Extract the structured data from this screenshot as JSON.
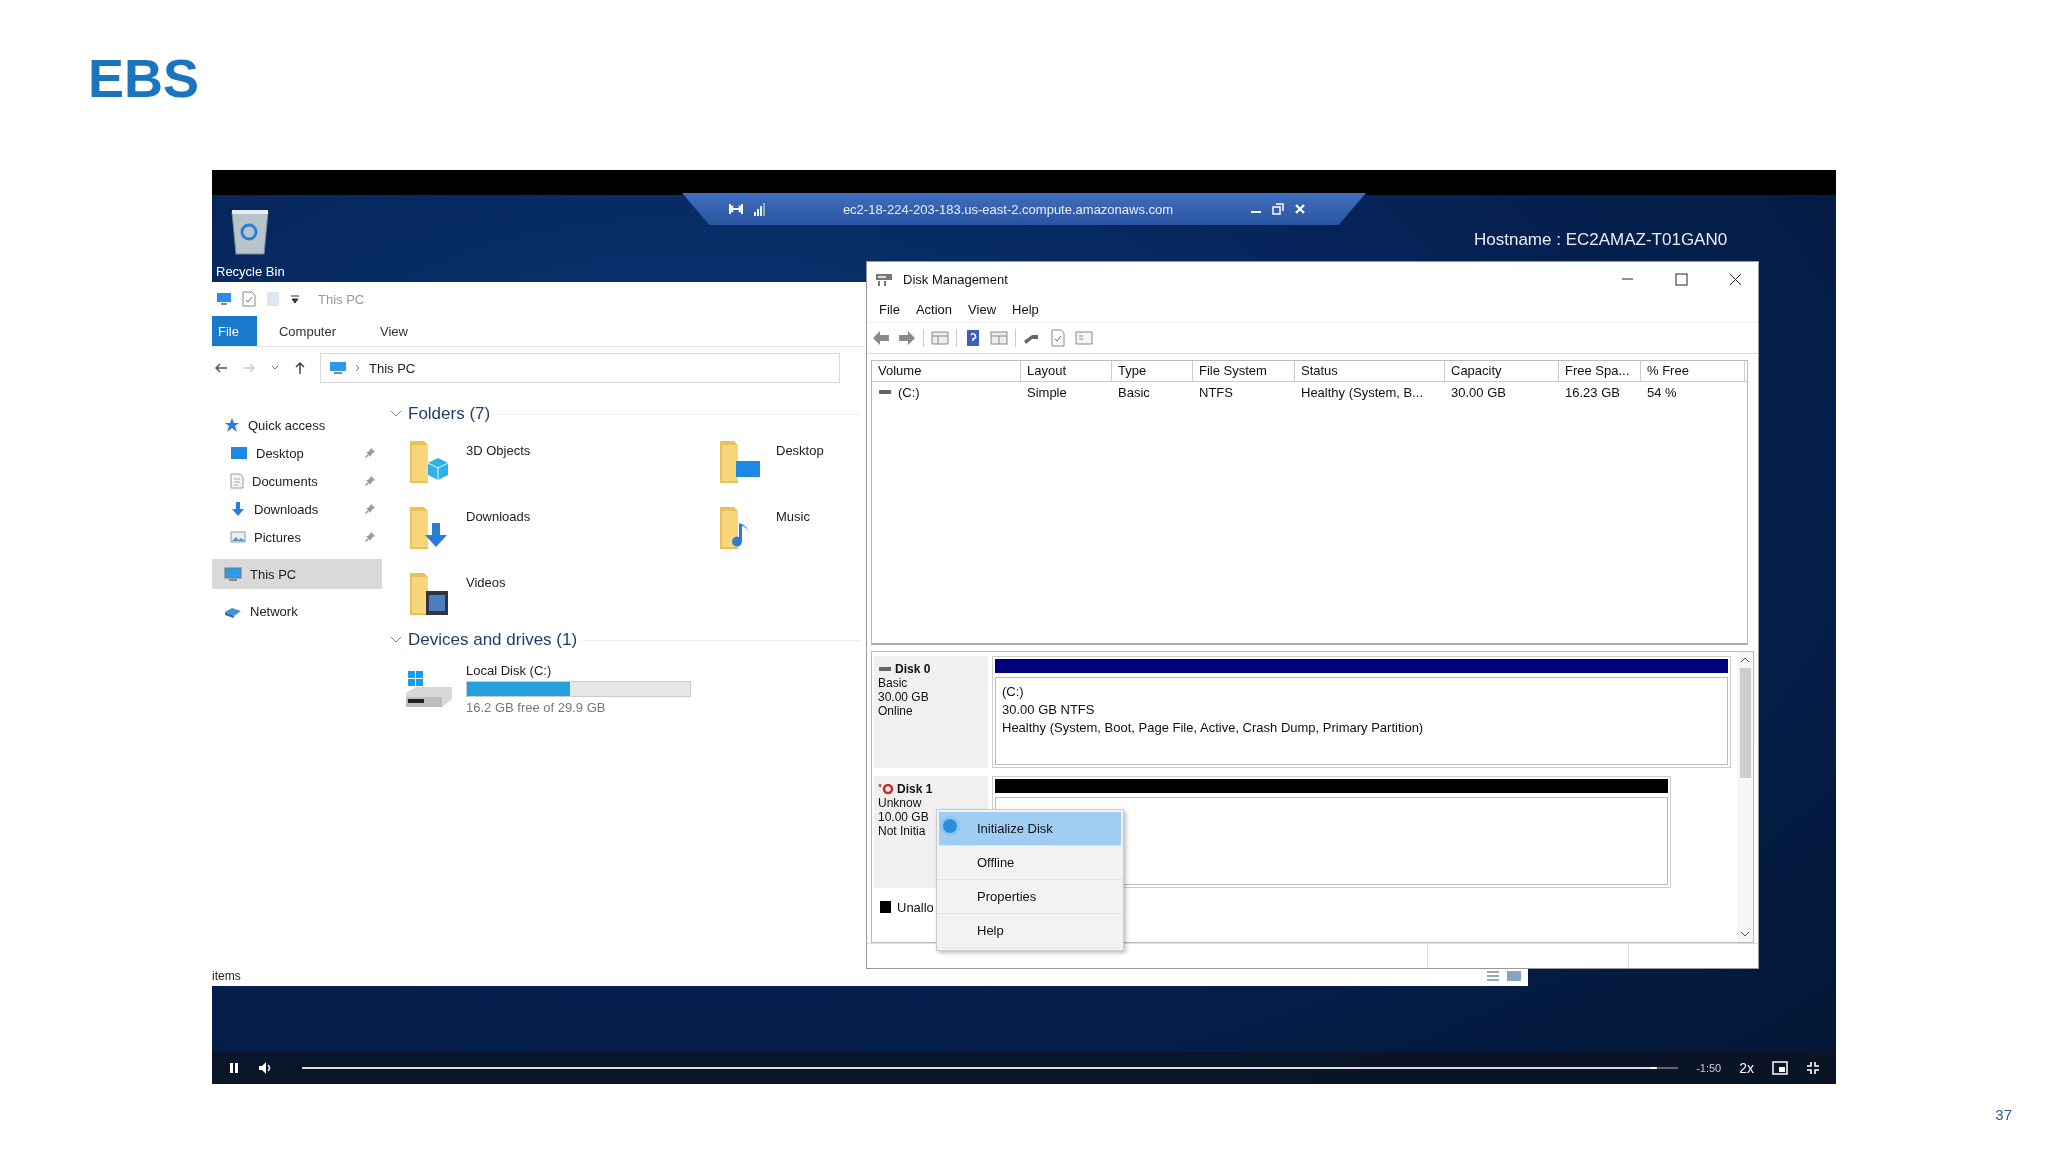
{
  "slide": {
    "title": "EBS",
    "page_number": "37"
  },
  "rdp_bar": {
    "host": "ec2-18-224-203-183.us-east-2.compute.amazonaws.com"
  },
  "desktop": {
    "icons": [
      {
        "label": "Recycle Bin"
      }
    ],
    "hostname": "Hostname : EC2AMAZ-T01GAN0"
  },
  "explorer": {
    "title": "This PC",
    "ribbon_tabs": [
      {
        "label": "File",
        "selected": true
      },
      {
        "label": "Computer",
        "selected": false
      },
      {
        "label": "View",
        "selected": false
      }
    ],
    "address": "This PC",
    "nav": [
      {
        "label": "Quick access",
        "selected": false,
        "children": [
          {
            "label": "Desktop",
            "pinned": true
          },
          {
            "label": "Documents",
            "pinned": true
          },
          {
            "label": "Downloads",
            "pinned": true
          },
          {
            "label": "Pictures",
            "pinned": true
          }
        ]
      },
      {
        "label": "This PC",
        "selected": true
      },
      {
        "label": "Network",
        "selected": false
      }
    ],
    "folders_heading": "Folders (7)",
    "folders": [
      {
        "label": "3D Objects"
      },
      {
        "label": "Desktop"
      },
      {
        "label": "Downloads"
      },
      {
        "label": "Music"
      },
      {
        "label": "Videos"
      }
    ],
    "devices_heading": "Devices and drives (1)",
    "drives": [
      {
        "name": "Local Disk (C:)",
        "level": 0.46,
        "free": "16.2 GB free of 29.9 GB"
      }
    ],
    "status": "items"
  },
  "disk_management": {
    "title": "Disk Management",
    "menu": [
      "File",
      "Action",
      "View",
      "Help"
    ],
    "columns": [
      "Volume",
      "Layout",
      "Type",
      "File System",
      "Status",
      "Capacity",
      "Free Spa...",
      "% Free"
    ],
    "rows": [
      [
        "(C:)",
        "Simple",
        "Basic",
        "NTFS",
        "Healthy (System, B...",
        "30.00 GB",
        "16.23 GB",
        "54 %"
      ]
    ],
    "disks": [
      {
        "kind": "online",
        "name": "Disk 0",
        "lines": [
          "Basic",
          "30.00 GB",
          "Online"
        ],
        "partition": {
          "color": "#00007f",
          "title": "(C:)",
          "lines": [
            "30.00 GB NTFS",
            "Healthy (System, Boot, Page File, Active, Crash Dump, Primary Partition)"
          ]
        }
      },
      {
        "kind": "unknown",
        "name": "Disk 1",
        "lines": [
          "Unknow",
          "10.00 GB",
          "Not Initia"
        ],
        "partition": {
          "color": "#000000"
        }
      }
    ],
    "legend": [
      {
        "label": "Unallo",
        "color": "#000000"
      }
    ],
    "context_menu": [
      {
        "label": "Initialize Disk",
        "selected": true
      },
      {
        "label": "Offline",
        "selected": false
      },
      {
        "label": "Properties",
        "selected": false
      },
      {
        "label": "Help",
        "selected": false
      }
    ]
  },
  "player": {
    "level": 0.98,
    "time": "-1:50",
    "speed": "2x"
  }
}
